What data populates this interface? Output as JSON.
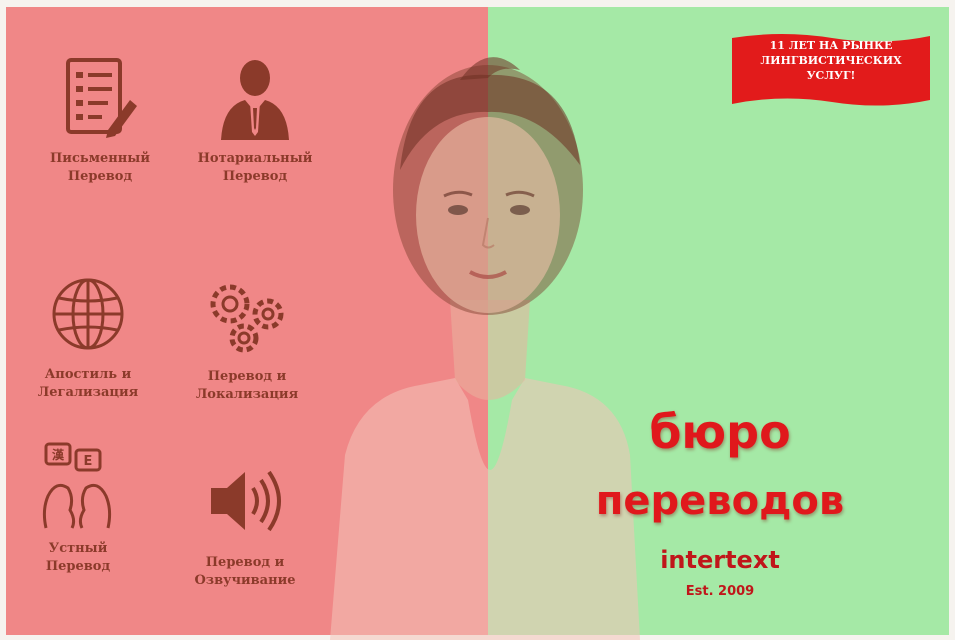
{
  "banner": {
    "lines": [
      "11 ЛЕТ НА РЫНКЕ",
      "ЛИНГВИСТИЧЕСКИХ",
      "УСЛУГ!"
    ],
    "color": "#e21b1b"
  },
  "services": [
    {
      "icon": "document-pen-icon",
      "line1": "Письменный",
      "line2": "Перевод"
    },
    {
      "icon": "businessman-icon",
      "line1": "Нотариальный",
      "line2": "Перевод"
    },
    {
      "icon": "globe-icon",
      "line1": "Апостиль и",
      "line2": "Легализация"
    },
    {
      "icon": "gears-icon",
      "line1": "Перевод и",
      "line2": "Локализация"
    },
    {
      "icon": "interpreters-icon",
      "line1": "Устный",
      "line2": "Перевод"
    },
    {
      "icon": "speaker-icon",
      "line1": "Перевод и",
      "line2": "Озвучивание"
    }
  ],
  "brand": {
    "line1": "бюро",
    "line2": "переводов",
    "name": "intertext",
    "established": "Est. 2009"
  },
  "colors": {
    "left_panel": "#f08787",
    "right_panel": "#a5e9a6",
    "icon": "#8b3a2a",
    "brand_red": "#e0181c"
  }
}
